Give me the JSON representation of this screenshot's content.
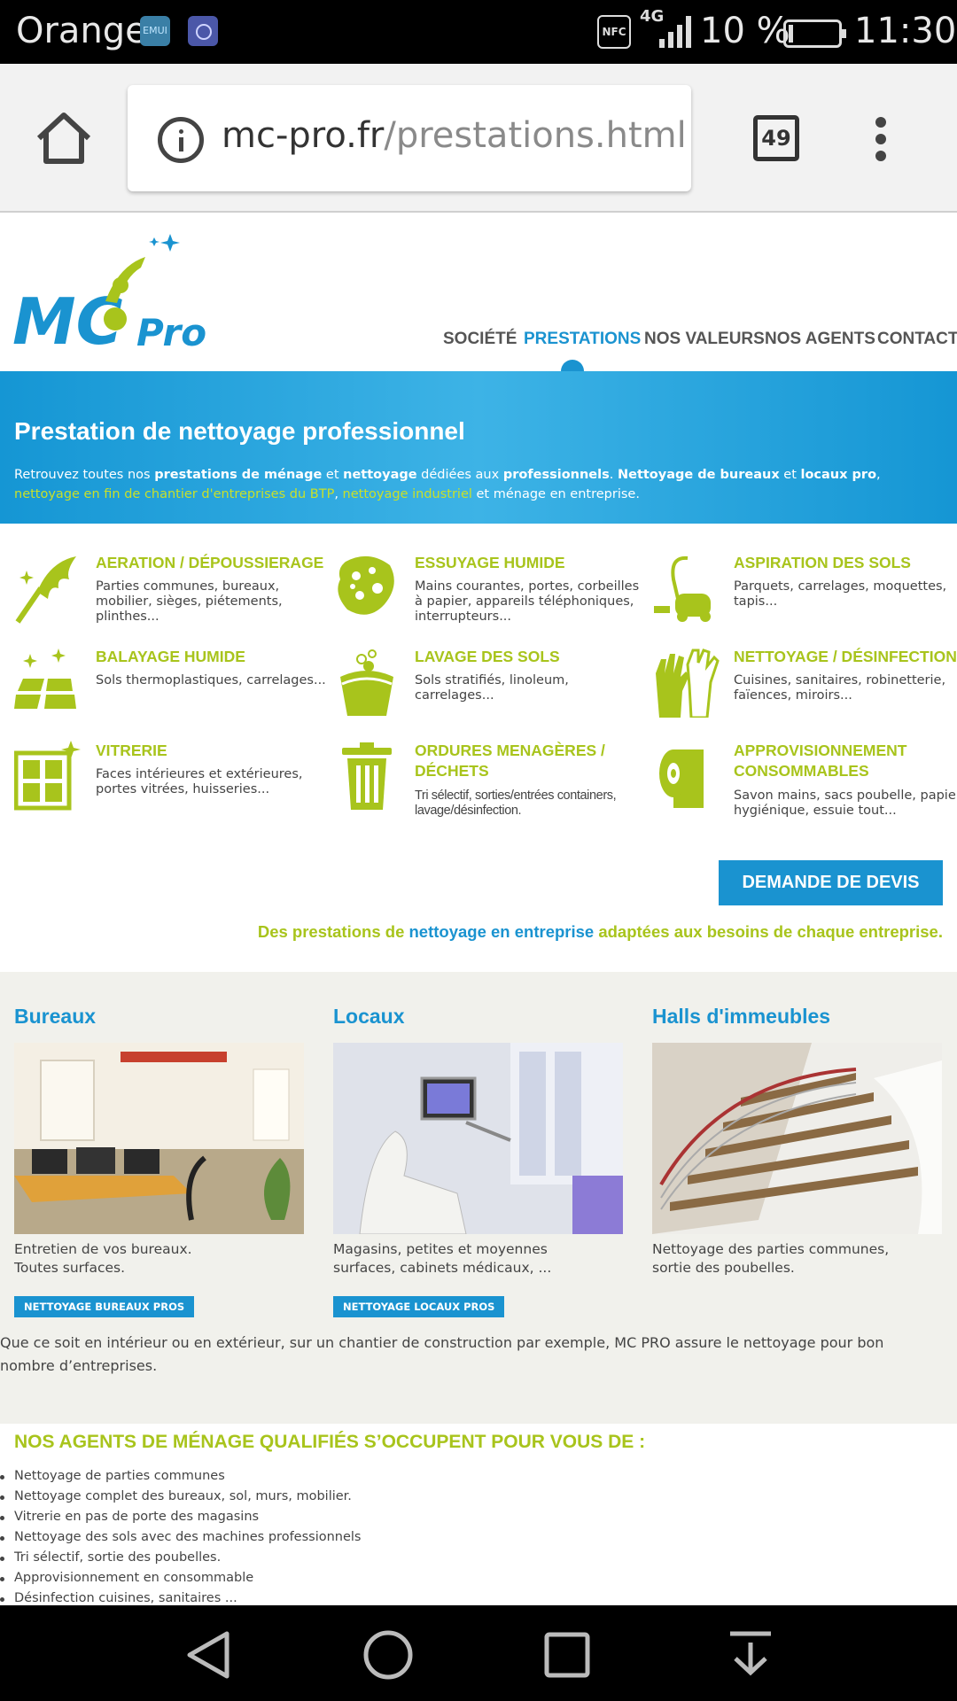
{
  "statusbar": {
    "carrier": "Orange",
    "app1_label": "EMUI",
    "nfc": "NFC",
    "network": "4G",
    "battery_pct": "10 %",
    "battery_level": 0.1,
    "time": "11:30"
  },
  "browser": {
    "url_domain": "mc-pro.fr",
    "url_path": "/prestations.html",
    "tab_count": "49"
  },
  "site": {
    "nav": [
      "SOCIÉTÉ",
      "PRESTATIONS",
      "NOS VALEURS",
      "NOS AGENTS",
      "CONTACT"
    ],
    "active_nav": "PRESTATIONS",
    "hero": {
      "title": "Prestation de nettoyage professionnel",
      "t1": "Retrouvez toutes nos ",
      "b1": "prestations de ménage",
      "t2": " et ",
      "b2": "nettoyage",
      "t3": " dédiées aux ",
      "b3": "professionnels",
      "t4": ". ",
      "b4": "Nettoyage de bureaux",
      "t5": " et ",
      "b5": "locaux pro",
      "t6": ", ",
      "l1": "nettoyage en fin de chantier d'entreprises du BTP",
      "t7": ", ",
      "l2": "nettoyage industriel",
      "t8": " et ménage en entreprise."
    },
    "services": [
      {
        "title": "AERATION / DÉPOUSSIERAGE",
        "desc": "Parties communes, bureaux, mobilier, sièges, piétements, plinthes...",
        "icon": "duster-icon"
      },
      {
        "title": "ESSUYAGE HUMIDE",
        "desc": "Mains courantes, portes, corbeilles à papier, appareils téléphoniques, interrupteurs...",
        "icon": "sponge-icon"
      },
      {
        "title": "ASPIRATION DES SOLS",
        "desc": "Parquets, carrelages, moquettes, tapis...",
        "icon": "vacuum-icon"
      },
      {
        "title": "BALAYAGE HUMIDE",
        "desc": "Sols thermoplastiques, carrelages...",
        "icon": "floor-tiles-icon"
      },
      {
        "title": "LAVAGE DES SOLS",
        "desc": "Sols stratifiés, linoleum, carrelages...",
        "icon": "bucket-icon"
      },
      {
        "title": "NETTOYAGE / DÉSINFECTION",
        "desc": "Cuisines, sanitaires, robinetterie, faïences, miroirs...",
        "icon": "gloves-icon"
      },
      {
        "title": "VITRERIE",
        "desc": "Faces intérieures et extérieures, portes vitrées, huisseries...",
        "icon": "window-icon"
      },
      {
        "title": "ORDURES MENAGÈRES / DÉCHETS",
        "desc": "Tri sélectif, sorties/entrées containers, lavage/désinfection.",
        "icon": "trash-icon"
      },
      {
        "title": "APPROVISIONNEMENT CONSOMMABLES",
        "desc": "Savon mains, sacs poubelle, papier hygiénique, essuie tout...",
        "icon": "paper-roll-icon"
      }
    ],
    "devis_button": "DEMANDE DE DEVIS",
    "tagline": {
      "a": "Des prestations de ",
      "b": "nettoyage en entreprise",
      "c": " adaptées aux besoins de chaque entreprise."
    },
    "cards": [
      {
        "title": "Bureaux",
        "text1": "Entretien de vos bureaux.",
        "text2": "Toutes surfaces.",
        "button": "NETTOYAGE BUREAUX PROS"
      },
      {
        "title": "Locaux",
        "text1": "Magasins, petites et moyennes",
        "text2": "surfaces, cabinets médicaux, ...",
        "button": "NETTOYAGE LOCAUX PROS"
      },
      {
        "title": "Halls d'immeubles",
        "text1": "Nettoyage des parties communes,",
        "text2": "sortie des poubelles.",
        "button": ""
      }
    ],
    "grey_paragraph": "Que ce soit en intérieur ou en extérieur, sur un chantier de construction par exemple, MC PRO assure le nettoyage pour bon nombre d’entreprises.",
    "agents_title": "NOS AGENTS DE MÉNAGE QUALIFIÉS S’OCCUPENT POUR VOUS DE :",
    "agents": [
      "Nettoyage de parties communes",
      "Nettoyage complet des bureaux, sol, murs, mobilier.",
      "Vitrerie en pas de porte des magasins",
      "Nettoyage des sols avec des machines professionnels",
      "Tri sélectif, sortie des poubelles.",
      "Approvisionnement en consommable",
      "Désinfection cuisines, sanitaires ..."
    ]
  },
  "colors": {
    "brand_blue": "#1a93d0",
    "lime": "#a8c41c"
  }
}
